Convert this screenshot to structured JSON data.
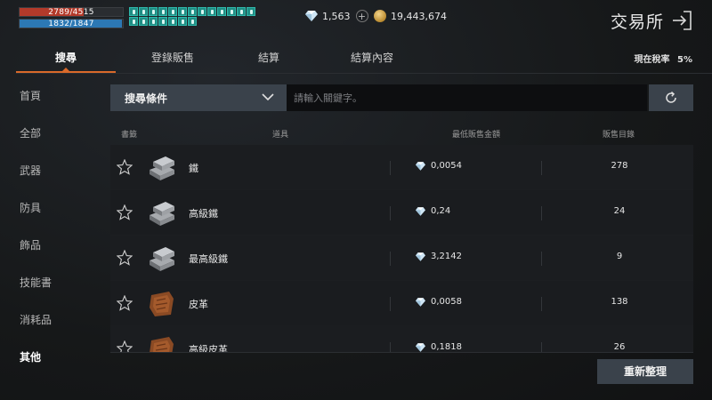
{
  "hud": {
    "hp_text": "2789/4515",
    "hp_fraction": 0.62,
    "mp_text": "1832/1847",
    "mp_fraction": 0.99,
    "buff_count": 20
  },
  "currency": {
    "diamonds": "1,563",
    "gold": "19,443,674"
  },
  "header": {
    "title": "交易所"
  },
  "tabs": [
    {
      "label": "搜尋",
      "active": true
    },
    {
      "label": "登錄販售",
      "active": false
    },
    {
      "label": "結算",
      "active": false
    },
    {
      "label": "結算內容",
      "active": false
    }
  ],
  "tax": {
    "label": "現在稅率",
    "value": "5%"
  },
  "sidebar": {
    "items": [
      {
        "label": "首頁"
      },
      {
        "label": "全部"
      },
      {
        "label": "武器"
      },
      {
        "label": "防具"
      },
      {
        "label": "飾品"
      },
      {
        "label": "技能書"
      },
      {
        "label": "消耗品"
      },
      {
        "label": "其他",
        "active": true
      }
    ]
  },
  "search": {
    "condition_label": "搜尋條件",
    "placeholder": "請輸入關鍵字。"
  },
  "table": {
    "columns": [
      "書籤",
      "道具",
      "最低販售金額",
      "販售目錄"
    ],
    "rows": [
      {
        "name": "鐵",
        "price": "0,0054",
        "count": "278",
        "icon": "iron-ingot-icon"
      },
      {
        "name": "高級鐵",
        "price": "0,24",
        "count": "24",
        "icon": "iron-ingot-icon"
      },
      {
        "name": "最高級鐵",
        "price": "3,2142",
        "count": "9",
        "icon": "iron-ingot-icon"
      },
      {
        "name": "皮革",
        "price": "0,0058",
        "count": "138",
        "icon": "leather-icon"
      },
      {
        "name": "高級皮革",
        "price": "0,1818",
        "count": "26",
        "icon": "leather-icon"
      }
    ]
  },
  "actions": {
    "reorganize_label": "重新整理"
  },
  "colors": {
    "accent": "#d9692a",
    "hp": "#b33a2a",
    "mp": "#2c78b4",
    "buff": "#1f8f85",
    "button": "#3a424b"
  }
}
